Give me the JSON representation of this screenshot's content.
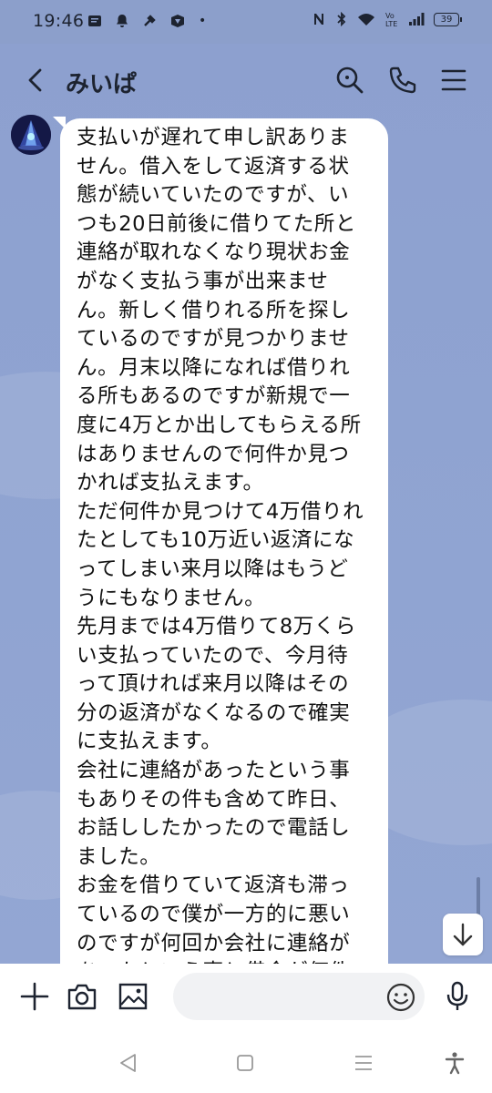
{
  "status_bar": {
    "time": "19:46",
    "battery": "39",
    "notif_dot": "•"
  },
  "header": {
    "title": "みいぱ"
  },
  "message": {
    "text": "支払いが遅れて申し訳ありません。借入をして返済する状態が続いていたのですが、いつも20日前後に借りてた所と連絡が取れなくなり現状お金がなく支払う事が出来ません。新しく借りれる所を探しているのですが見つかりません。月末以降になれば借りれる所もあるのですが新規で一度に4万とか出してもらえる所はありませんので何件か見つかれば支払えます。\nただ何件か見つけて4万借りれたとしても10万近い返済になってしまい来月以降はもうどうにもなりません。\n先月までは4万借りて8万くらい支払っていたので、今月待って頂ければ来月以降はその分の返済がなくなるので確実に支払えます。\n会社に連絡があったという事もありその件も含めて昨日、お話ししたかったので電話しました。\nお金を借りていて返済も滞っているので僕が一方的に悪いのですが何回か会社に連絡があったという事と借金が何件もあるの"
  },
  "input": {
    "placeholder": "",
    "value": ""
  },
  "icons": {
    "back": "chevron-left-icon",
    "search": "search-icon",
    "call": "phone-icon",
    "menu": "hamburger-menu-icon",
    "plus": "plus-icon",
    "camera": "camera-icon",
    "image": "image-icon",
    "emoji": "emoji-icon",
    "mic": "microphone-icon",
    "scroll_down": "arrow-down-icon"
  },
  "colors": {
    "chat_background": "#8fa3d1",
    "bubble": "#ffffff",
    "text": "#111111"
  }
}
